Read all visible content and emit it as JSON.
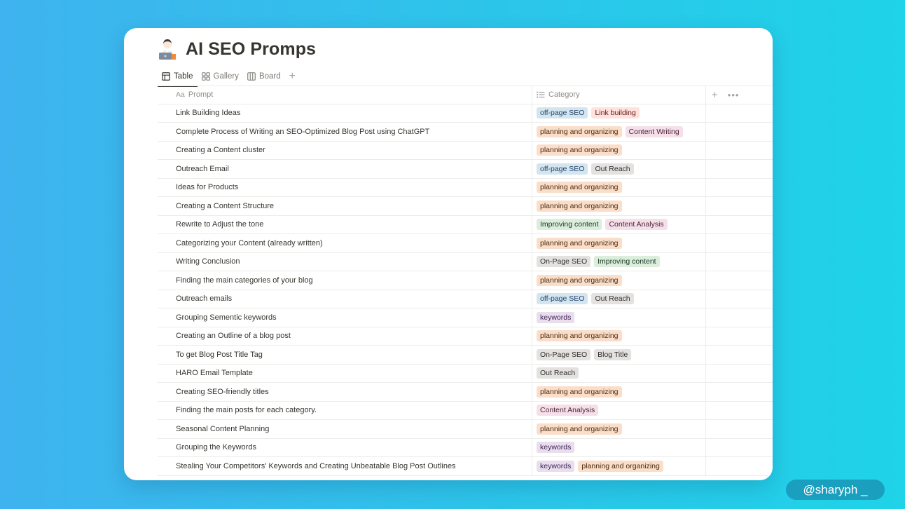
{
  "page": {
    "title": "AI SEO Promps",
    "icon": "laptop-person-icon"
  },
  "tabs": [
    {
      "label": "Table",
      "icon": "table-icon",
      "active": true
    },
    {
      "label": "Gallery",
      "icon": "gallery-icon",
      "active": false
    },
    {
      "label": "Board",
      "icon": "board-icon",
      "active": false
    }
  ],
  "columns": {
    "prompt": "Prompt",
    "prompt_icon": "Aa",
    "category": "Category"
  },
  "tag_colors": {
    "off-page SEO": {
      "bg": "#d3e5ef",
      "fg": "#28456c"
    },
    "Link building": {
      "bg": "#ffe2dd",
      "fg": "#5d1715"
    },
    "planning and organizing": {
      "bg": "#fadec9",
      "fg": "#49290e"
    },
    "Content Writing": {
      "bg": "#f5e0e9",
      "fg": "#4c2337"
    },
    "Out Reach": {
      "bg": "#e3e2e0",
      "fg": "#32302c"
    },
    "Improving content": {
      "bg": "#dbeddb",
      "fg": "#1c3829"
    },
    "Content Analysis": {
      "bg": "#f5e0e9",
      "fg": "#4c2337"
    },
    "On-Page SEO": {
      "bg": "#e3e2e0",
      "fg": "#32302c"
    },
    "keywords": {
      "bg": "#e8deee",
      "fg": "#412454"
    },
    "Blog Title": {
      "bg": "#e3e2e0",
      "fg": "#32302c"
    }
  },
  "rows": [
    {
      "prompt": "Link Building Ideas",
      "tags": [
        "off-page SEO",
        "Link building"
      ]
    },
    {
      "prompt": "Complete Process of Writing an SEO-Optimized Blog Post using ChatGPT",
      "tags": [
        "planning and organizing",
        "Content Writing"
      ]
    },
    {
      "prompt": "Creating a Content cluster",
      "tags": [
        "planning and organizing"
      ]
    },
    {
      "prompt": "Outreach Email",
      "tags": [
        "off-page SEO",
        "Out Reach"
      ]
    },
    {
      "prompt": "Ideas for Products",
      "tags": [
        "planning and organizing"
      ]
    },
    {
      "prompt": "Creating a Content Structure",
      "tags": [
        "planning and organizing"
      ]
    },
    {
      "prompt": "Rewrite to Adjust the tone",
      "tags": [
        "Improving content",
        "Content Analysis"
      ]
    },
    {
      "prompt": "Categorizing your Content (already written)",
      "tags": [
        "planning and organizing"
      ]
    },
    {
      "prompt": "Writing Conclusion",
      "tags": [
        "On-Page SEO",
        "Improving content"
      ]
    },
    {
      "prompt": "Finding the main categories of your blog",
      "tags": [
        "planning and organizing"
      ]
    },
    {
      "prompt": "Outreach emails",
      "tags": [
        "off-page SEO",
        "Out Reach"
      ]
    },
    {
      "prompt": "Grouping Sementic keywords",
      "tags": [
        "keywords"
      ]
    },
    {
      "prompt": "Creating an Outline of a blog post",
      "tags": [
        "planning and organizing"
      ]
    },
    {
      "prompt": "To get Blog Post Title Tag",
      "tags": [
        "On-Page SEO",
        "Blog Title"
      ]
    },
    {
      "prompt": "HARO Email Template",
      "tags": [
        "Out Reach"
      ]
    },
    {
      "prompt": "Creating SEO-friendly titles",
      "tags": [
        "planning and organizing"
      ]
    },
    {
      "prompt": "Finding the main posts for each category.",
      "tags": [
        "Content Analysis"
      ]
    },
    {
      "prompt": "Seasonal Content Planning",
      "tags": [
        "planning and organizing"
      ]
    },
    {
      "prompt": "Grouping the Keywords",
      "tags": [
        "keywords"
      ]
    },
    {
      "prompt": "Stealing Your Competitors' Keywords and Creating Unbeatable Blog Post Outlines",
      "tags": [
        "keywords",
        "planning and organizing"
      ]
    }
  ],
  "watermark": {
    "handle": "@sharyph _"
  }
}
